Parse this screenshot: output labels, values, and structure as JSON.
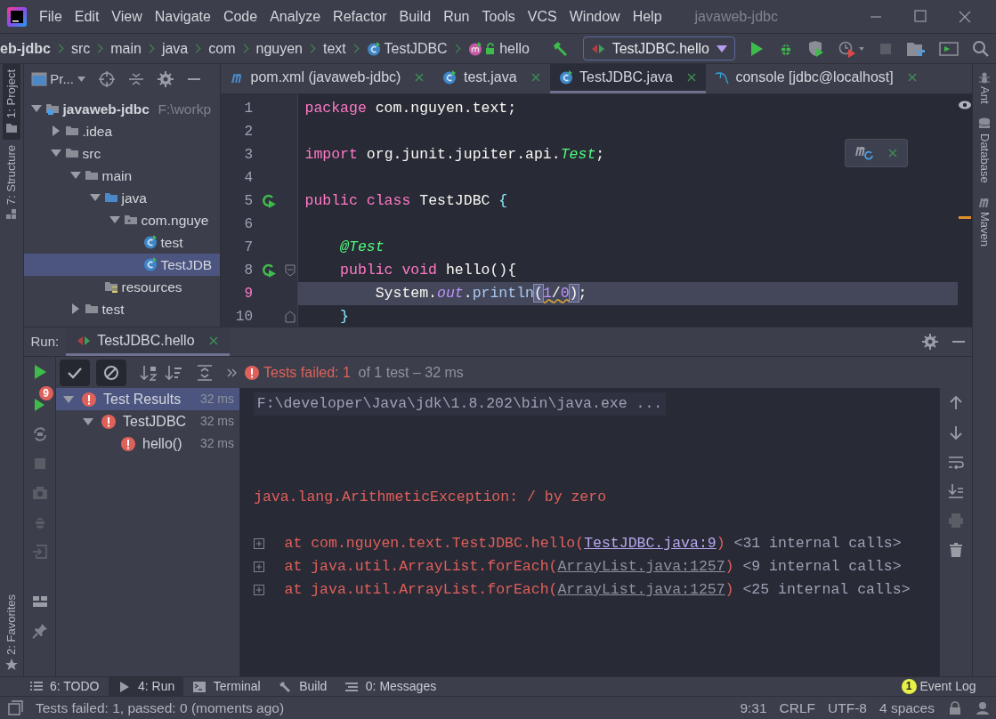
{
  "title_bar": {
    "menus": [
      "File",
      "Edit",
      "View",
      "Navigate",
      "Code",
      "Analyze",
      "Refactor",
      "Build",
      "Run",
      "Tools",
      "VCS",
      "Window",
      "Help"
    ],
    "title": "javaweb-jdbc"
  },
  "breadcrumb": [
    {
      "label": "eb-jdbc",
      "kind": "project"
    },
    {
      "label": "src",
      "kind": "plain"
    },
    {
      "label": "main",
      "kind": "plain"
    },
    {
      "label": "java",
      "kind": "plain"
    },
    {
      "label": "com",
      "kind": "plain"
    },
    {
      "label": "nguyen",
      "kind": "plain"
    },
    {
      "label": "text",
      "kind": "plain"
    },
    {
      "label": "TestJDBC",
      "kind": "class"
    },
    {
      "label": "hello",
      "kind": "method"
    }
  ],
  "run_config": "TestJDBC.hello",
  "left_strip": [
    {
      "label": "1: Project",
      "kind": "project",
      "selected": true
    },
    {
      "label": "7: Structure",
      "kind": "structure",
      "selected": false
    },
    {
      "label": "2: Favorites",
      "kind": "favorites",
      "selected": false
    }
  ],
  "right_strip": [
    {
      "label": "Ant",
      "kind": "ant"
    },
    {
      "label": "Database",
      "kind": "database"
    },
    {
      "label": "Maven",
      "kind": "maven"
    }
  ],
  "project_panel": {
    "title": "Pr...",
    "tree": [
      {
        "label": "javaweb-jdbc",
        "hint": "F:\\workp",
        "kind": "project",
        "expanded": true,
        "selected": false,
        "children": [
          {
            "label": ".idea",
            "kind": "folder",
            "expanded": false,
            "selected": false
          },
          {
            "label": "src",
            "kind": "folder",
            "expanded": true,
            "selected": false,
            "children": [
              {
                "label": "main",
                "kind": "folder",
                "expanded": true,
                "selected": false,
                "children": [
                  {
                    "label": "java",
                    "kind": "source",
                    "expanded": true,
                    "selected": false,
                    "children": [
                      {
                        "label": "com.nguye",
                        "kind": "package",
                        "expanded": true,
                        "selected": false,
                        "children": [
                          {
                            "label": "test",
                            "kind": "class",
                            "selected": false
                          },
                          {
                            "label": "TestJDB",
                            "kind": "class",
                            "selected": true
                          }
                        ]
                      }
                    ]
                  },
                  {
                    "label": "resources",
                    "kind": "resources",
                    "selected": false
                  }
                ]
              },
              {
                "label": "test",
                "kind": "folder",
                "expanded": false,
                "selected": false
              }
            ]
          }
        ]
      }
    ]
  },
  "editor_tabs": [
    {
      "label": "pom.xml (javaweb-jdbc)",
      "kind": "maven",
      "selected": false
    },
    {
      "label": "test.java",
      "kind": "class",
      "selected": false
    },
    {
      "label": "TestJDBC.java",
      "kind": "class",
      "selected": true
    },
    {
      "label": "console [jdbc@localhost]",
      "kind": "sql",
      "selected": false
    }
  ],
  "code": [
    {
      "number": "1",
      "tokens": [
        {
          "text": "package",
          "kind": "kw"
        },
        {
          "text": " com.nguyen.text;",
          "kind": "plain"
        }
      ]
    },
    {
      "number": "2"
    },
    {
      "number": "3",
      "tokens": [
        {
          "text": "import",
          "kind": "kw"
        },
        {
          "text": " org.junit.jupiter.api.",
          "kind": "plain"
        },
        {
          "text": "Test",
          "kind": "type"
        },
        {
          "text": ";",
          "kind": "plain"
        }
      ]
    },
    {
      "number": "4"
    },
    {
      "number": "5",
      "run": true,
      "tokens": [
        {
          "text": "public class",
          "kind": "kw"
        },
        {
          "text": " TestJDBC ",
          "kind": "plain"
        },
        {
          "text": "{",
          "kind": "brace"
        }
      ]
    },
    {
      "number": "6"
    },
    {
      "number": "7",
      "tokens": [
        {
          "text": "    @Test",
          "kind": "ann"
        }
      ]
    },
    {
      "number": "8",
      "run": true,
      "fold_start": true,
      "tokens": [
        {
          "text": "    public void",
          "kind": "kw"
        },
        {
          "text": " hello(){",
          "kind": "plain"
        }
      ]
    },
    {
      "number": "9",
      "current": true,
      "tokens": [
        {
          "text": "        System.",
          "kind": "plain"
        },
        {
          "text": "out",
          "kind": "field"
        },
        {
          "text": ".",
          "kind": "plain"
        },
        {
          "text": "println",
          "kind": "method"
        },
        {
          "text": "(",
          "kind": "match"
        },
        {
          "text": "1",
          "kind": "warn"
        },
        {
          "text": "/",
          "kind": "warnop"
        },
        {
          "text": "0",
          "kind": "warn"
        },
        {
          "text": ")",
          "kind": "match"
        },
        {
          "text": ";",
          "kind": "plain"
        }
      ]
    },
    {
      "number": "10",
      "fold_end": true,
      "tokens": [
        {
          "text": "    }",
          "kind": "brace"
        }
      ]
    }
  ],
  "run_panel": {
    "label": "Run:",
    "tab": "TestJDBC.hello",
    "rerun_badge": "9",
    "status": {
      "failed": "Tests failed: 1",
      "rest": "of 1 test – 32 ms"
    },
    "results": [
      {
        "label": "Test Results",
        "time": "32 ms",
        "expanded": true,
        "selected": true,
        "children": [
          {
            "label": "TestJDBC",
            "time": "32 ms",
            "expanded": true,
            "selected": false,
            "children": [
              {
                "label": "hello()",
                "time": "32 ms",
                "selected": false
              }
            ]
          }
        ]
      }
    ],
    "console": [
      {
        "kind": "command",
        "text": "F:\\developer\\Java\\jdk\\1.8.202\\bin\\java.exe ..."
      },
      {
        "kind": "error",
        "text": "java.lang.ArithmeticException: / by zero"
      },
      {
        "kind": "frame",
        "prefix": "at com.nguyen.text.TestJDBC.hello(",
        "link": "TestJDBC.java:9",
        "visited": true,
        "suffix": ")",
        "note": "<31 internal calls>"
      },
      {
        "kind": "frame",
        "prefix": "at java.util.ArrayList.forEach(",
        "link": "ArrayList.java:1257",
        "visited": false,
        "suffix": ")",
        "note": "<9 internal calls>"
      },
      {
        "kind": "frame",
        "prefix": "at java.util.ArrayList.forEach(",
        "link": "ArrayList.java:1257",
        "visited": false,
        "suffix": ")",
        "note": "<25 internal calls>"
      }
    ]
  },
  "bottom_tabs": [
    {
      "label": "6: TODO",
      "kind": "todo",
      "selected": false
    },
    {
      "label": "4: Run",
      "kind": "run",
      "selected": true
    },
    {
      "label": "Terminal",
      "kind": "terminal",
      "selected": false
    },
    {
      "label": "Build",
      "kind": "build",
      "selected": false
    },
    {
      "label": "0: Messages",
      "kind": "messages",
      "selected": false
    }
  ],
  "event_log": {
    "label": "Event Log",
    "count": "1"
  },
  "status_bar": {
    "message": "Tests failed: 1, passed: 0 (moments ago)",
    "items": [
      "9:31",
      "CRLF",
      "UTF-8",
      "4 spaces"
    ]
  }
}
